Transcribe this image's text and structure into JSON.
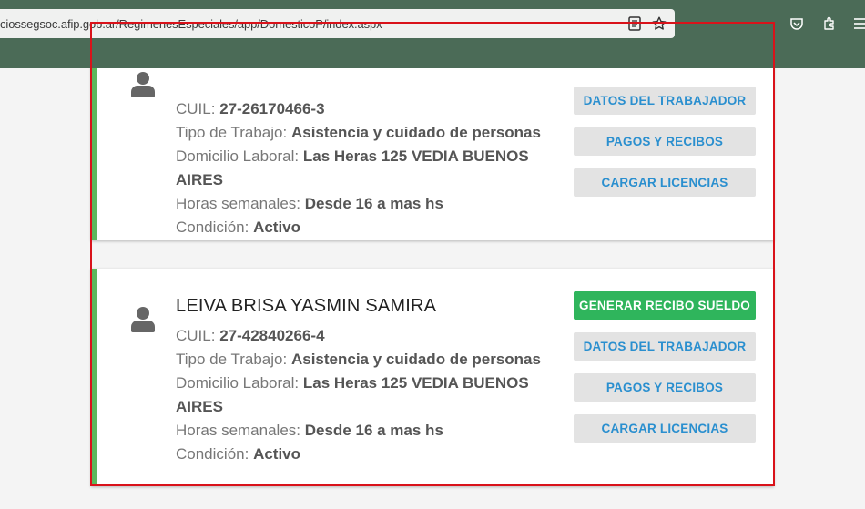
{
  "browser": {
    "url": "ciossegsoc.afip.gob.ar/RegimenesEspeciales/app/DomesticoP/index.aspx",
    "icons": [
      "reader-view-icon",
      "bookmark-star-icon",
      "pocket-icon",
      "extensions-icon",
      "menu-icon"
    ]
  },
  "workers": [
    {
      "name": "",
      "cuil_label": "CUIL:",
      "cuil": "27-26170466-3",
      "tipo_label": "Tipo de Trabajo:",
      "tipo": "Asistencia y cuidado de personas",
      "domicilio_label": "Domicilio Laboral:",
      "domicilio": "Las Heras 125 VEDIA BUENOS AIRES",
      "horas_label": "Horas semanales:",
      "horas": "Desde 16 a mas hs",
      "condicion_label": "Condición:",
      "condicion": "Activo",
      "btn_generar": "",
      "btn_datos": "DATOS DEL TRABAJADOR",
      "btn_pagos": "PAGOS Y RECIBOS",
      "btn_licencias": "CARGAR LICENCIAS"
    },
    {
      "name": "LEIVA BRISA YASMIN SAMIRA",
      "cuil_label": "CUIL:",
      "cuil": "27-42840266-4",
      "tipo_label": "Tipo de Trabajo:",
      "tipo": "Asistencia y cuidado de personas",
      "domicilio_label": "Domicilio Laboral:",
      "domicilio": "Las Heras 125 VEDIA BUENOS AIRES",
      "horas_label": "Horas semanales:",
      "horas": "Desde 16 a mas hs",
      "condicion_label": "Condición:",
      "condicion": "Activo",
      "btn_generar": "GENERAR RECIBO SUELDO",
      "btn_datos": "DATOS DEL TRABAJADOR",
      "btn_pagos": "PAGOS Y RECIBOS",
      "btn_licencias": "CARGAR LICENCIAS"
    }
  ],
  "colors": {
    "accent_green": "#2fb55c",
    "card_border": "#5cb85c",
    "link_blue": "#2a8fcf",
    "highlight_red": "#d9121a",
    "browser_bar": "#4b6b57"
  }
}
